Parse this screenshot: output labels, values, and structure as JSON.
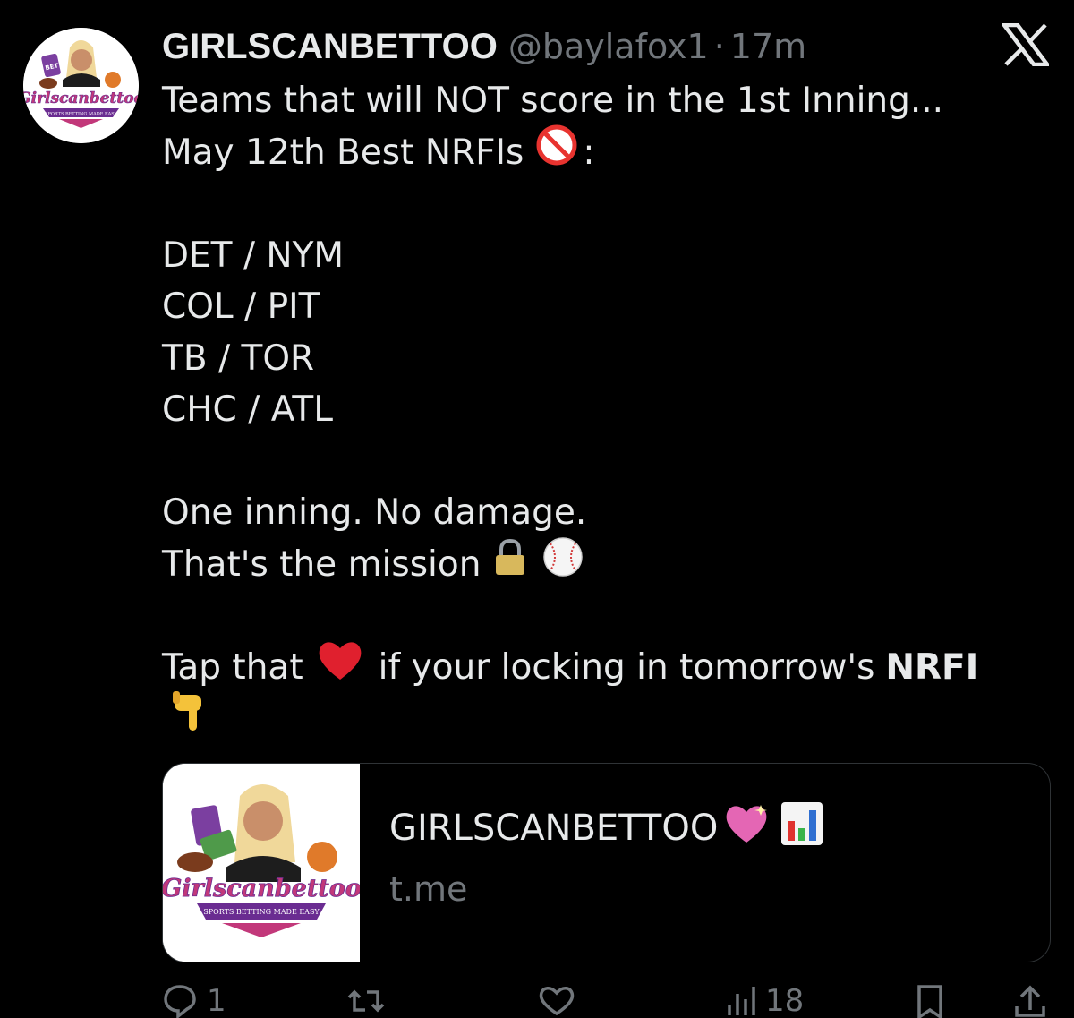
{
  "tweet": {
    "display_name": "GIRLSCANBETTOO",
    "handle": "@baylafox1",
    "separator": "·",
    "time": "17m",
    "lines": {
      "l1": "Teams that will NOT score in the 1st Inning...",
      "l2": "May 12th Best NRFIs",
      "l2_suffix": ":",
      "l3": "DET / NYM",
      "l4": "COL / PIT",
      "l5": "TB / TOR",
      "l6": "CHC / ATL",
      "l7": "One inning. No damage.",
      "l8": "That's the mission",
      "l9_a": "Tap that",
      "l9_b": "if your locking in tomorrow's",
      "l9_bold": "NRFI"
    }
  },
  "avatar": {
    "brand_text": "Girlscanbettoo",
    "tagline": "SPORTS BETTING MADE EASY",
    "badge": "BET"
  },
  "link_card": {
    "title": "GIRLSCANBETTOO",
    "domain": "t.me"
  },
  "actions": {
    "replies": "1",
    "views": "18"
  },
  "icons": {
    "prohibited": "no-entry-emoji-icon",
    "lock": "lock-emoji-icon",
    "baseball": "baseball-emoji-icon",
    "heart": "red-heart-emoji-icon",
    "point_down": "point-down-emoji-icon",
    "pink_heart": "sparkling-heart-emoji-icon",
    "bar_chart": "bar-chart-emoji-icon",
    "close": "x-close-icon"
  },
  "colors": {
    "background": "#000000",
    "text": "#e7e9ea",
    "muted": "#71767b",
    "border": "#2f3336",
    "brand_pink": "#c2387a",
    "brand_purple": "#6a2c91"
  }
}
